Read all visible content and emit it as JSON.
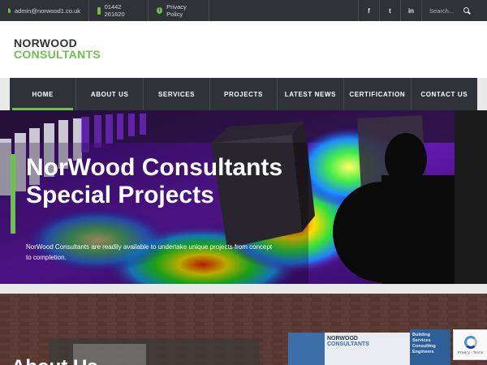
{
  "topbar": {
    "email": "admin@norwood1.co.uk",
    "phone": "01442 261620",
    "privacy": "Privacy Policy",
    "social": {
      "facebook": "f",
      "twitter": "t",
      "linkedin": "in"
    },
    "search_placeholder": "Search..."
  },
  "logo": {
    "line1": "NORWOOD",
    "line2": "CONSULTANTS"
  },
  "nav": {
    "items": [
      "HOME",
      "ABOUT US",
      "SERVICES",
      "PROJECTS",
      "LATEST NEWS",
      "CERTIFICATION",
      "CONTACT US"
    ],
    "active": "HOME"
  },
  "hero": {
    "title": "NorWood Consultants Special Projects",
    "text": "NorWood Consultants are readily available to undertake unique projects from concept to completion."
  },
  "lower": {
    "heading": "About Us",
    "sign_line1": "NORWOOD",
    "sign_line2": "CONSULTANTS",
    "sign_side": [
      "Building",
      "Services",
      "Consulting",
      "Engineers"
    ]
  },
  "recaptcha": {
    "links": "Privacy - Terms"
  },
  "colors": {
    "accent": "#6cc24a",
    "dark": "#2f3338"
  }
}
